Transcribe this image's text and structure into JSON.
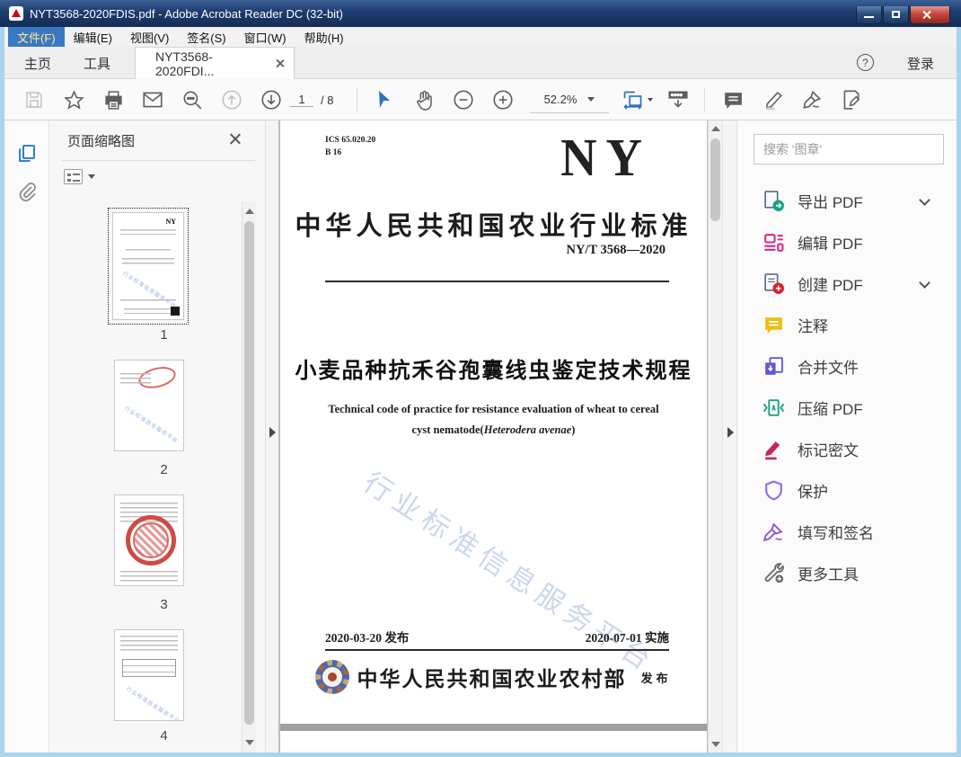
{
  "titlebar": {
    "title": "NYT3568-2020FDIS.pdf - Adobe Acrobat Reader DC (32-bit)"
  },
  "menu": {
    "items": [
      {
        "label": "文件(F)",
        "selected": true
      },
      {
        "label": "编辑(E)",
        "selected": false
      },
      {
        "label": "视图(V)",
        "selected": false
      },
      {
        "label": "签名(S)",
        "selected": false
      },
      {
        "label": "窗口(W)",
        "selected": false
      },
      {
        "label": "帮助(H)",
        "selected": false
      }
    ]
  },
  "tabbar": {
    "home": "主页",
    "tools": "工具",
    "doc_tab": "NYT3568-2020FDI...",
    "help_glyph": "?",
    "login": "登录"
  },
  "toolbar": {
    "page_current": "1",
    "page_total": "/ 8",
    "zoom_level": "52.2%"
  },
  "left_panel": {
    "title": "页面缩略图",
    "thumbnails": [
      {
        "num": "1",
        "selected": true
      },
      {
        "num": "2",
        "selected": false
      },
      {
        "num": "3",
        "selected": false
      },
      {
        "num": "4",
        "selected": false
      }
    ]
  },
  "document": {
    "ics_line1": "ICS 65.020.20",
    "ics_line2": "B 16",
    "logo": "NY",
    "standard_title": "中华人民共和国农业行业标准",
    "standard_no": "NY/T 3568—2020",
    "title": "小麦品种抗禾谷孢囊线虫鉴定技术规程",
    "subtitle_line1": "Technical code of practice for resistance evaluation of wheat to cereal",
    "subtitle_line2_pre": "cyst nematode(",
    "subtitle_italic": "Heterodera avenae",
    "subtitle_line2_post": ")",
    "watermark": "行业标准信息服务平台",
    "issue_date": "2020-03-20 发布",
    "impl_date": "2020-07-01 实施",
    "ministry": "中华人民共和国农业农村部",
    "publish": "发布"
  },
  "right_panel": {
    "search_placeholder": "搜索 '图章'",
    "tools": [
      {
        "label": "导出 PDF",
        "color": "#17a284",
        "chevron": true
      },
      {
        "label": "编辑 PDF",
        "color": "#d62a84",
        "chevron": false
      },
      {
        "label": "创建 PDF",
        "color": "#da1f26",
        "chevron": true
      },
      {
        "label": "注释",
        "color": "#efbf13",
        "chevron": false
      },
      {
        "label": "合并文件",
        "color": "#6159d1",
        "chevron": false
      },
      {
        "label": "压缩 PDF",
        "color": "#17a284",
        "chevron": false
      },
      {
        "label": "标记密文",
        "color": "#c9245d",
        "chevron": false
      },
      {
        "label": "保护",
        "color": "#7d74ea",
        "chevron": false
      },
      {
        "label": "填写和签名",
        "color": "#8a55d3",
        "chevron": false
      },
      {
        "label": "更多工具",
        "color": "#6b6b6b",
        "chevron": false
      }
    ]
  },
  "colors": {
    "titlebar": "#1d3c6e",
    "window_border": "#a9d4ec",
    "accent_blue": "#2a72c8",
    "menu_selected_bg": "#3a78c3",
    "menu_selected_text": "#ffe98c",
    "watermark_blue": "#a9bde4"
  }
}
